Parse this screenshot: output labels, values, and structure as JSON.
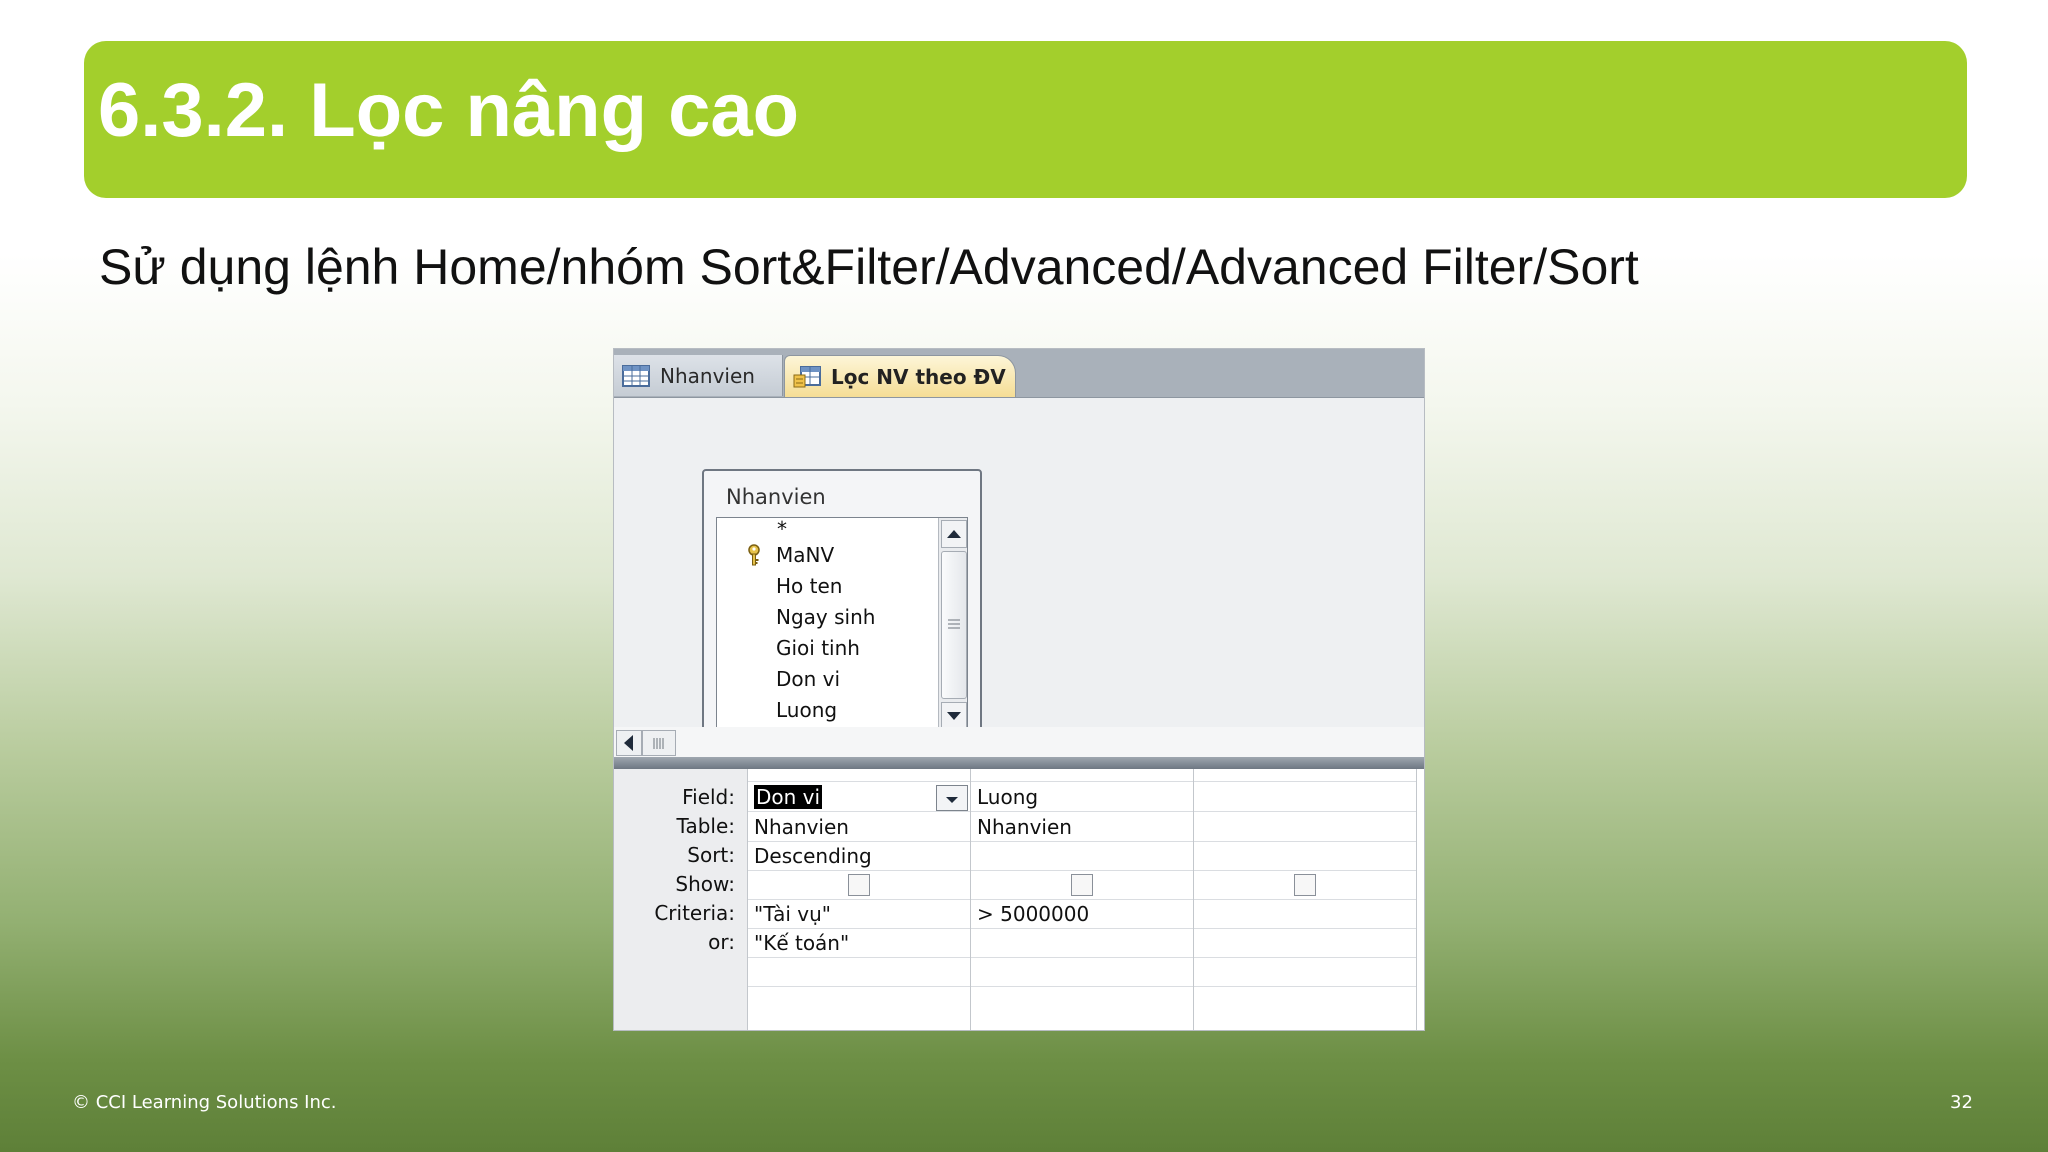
{
  "slide": {
    "title": "6.3.2. Lọc nâng cao",
    "subtitle": "Sử dụng lệnh Home/nhóm Sort&Filter/Advanced/Advanced Filter/Sort",
    "footer_copyright": "© CCI Learning Solutions Inc.",
    "page_number": "32"
  },
  "colors": {
    "title_bar": "#a3cf2c",
    "title_text": "#ffffff"
  },
  "access": {
    "tabs": [
      {
        "label": "Nhanvien",
        "icon": "table-icon",
        "active": false
      },
      {
        "label": "Lọc NV theo ĐV",
        "icon": "filter-query-icon",
        "active": true
      }
    ],
    "table_box": {
      "title": "Nhanvien",
      "fields": [
        "*",
        "MaNV",
        "Ho ten",
        "Ngay sinh",
        "Gioi tinh",
        "Don vi",
        "Luong"
      ],
      "primary_key": "MaNV"
    },
    "grid": {
      "row_labels": {
        "field": "Field:",
        "table": "Table:",
        "sort": "Sort:",
        "show": "Show:",
        "criteria": "Criteria:",
        "or": "or:"
      },
      "columns": [
        {
          "field": "Don vi",
          "table": "Nhanvien",
          "sort": "Descending",
          "show": false,
          "criteria": "\"Tài vụ\"",
          "or": "\"Kế toán\""
        },
        {
          "field": "Luong",
          "table": "Nhanvien",
          "sort": "",
          "show": false,
          "criteria": "> 5000000",
          "or": ""
        },
        {
          "field": "",
          "table": "",
          "sort": "",
          "show": false,
          "criteria": "",
          "or": ""
        }
      ]
    }
  }
}
